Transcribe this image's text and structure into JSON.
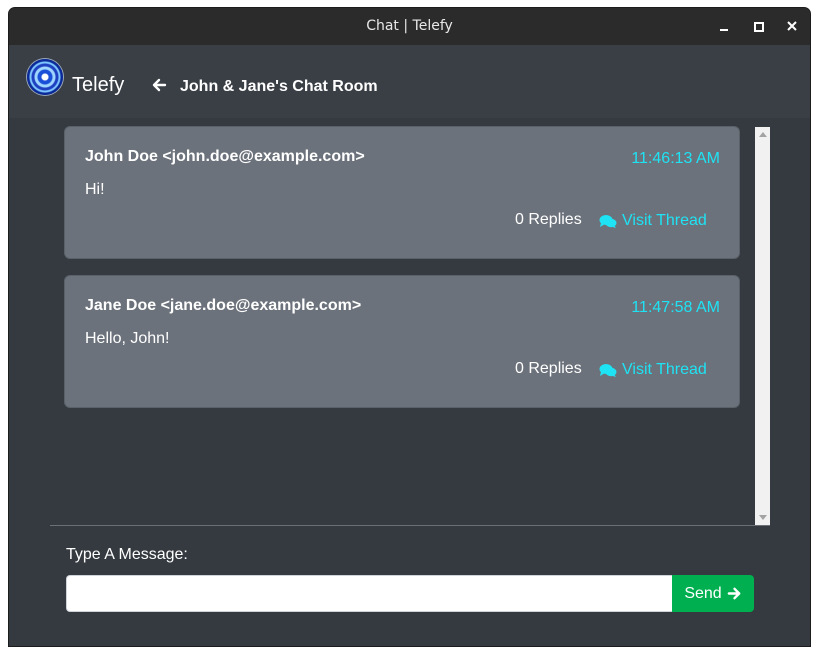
{
  "window": {
    "title": "Chat | Telefy"
  },
  "navbar": {
    "brand": "Telefy",
    "room_title": "John & Jane's Chat Room"
  },
  "messages": [
    {
      "author": "John Doe <john.doe@example.com>",
      "time": "11:46:13 AM",
      "text": "Hi!",
      "replies": "0 Replies",
      "visit_label": "Visit Thread"
    },
    {
      "author": "Jane Doe <jane.doe@example.com>",
      "time": "11:47:58 AM",
      "text": "Hello, John!",
      "replies": "0 Replies",
      "visit_label": "Visit Thread"
    }
  ],
  "composer": {
    "label": "Type A Message:",
    "value": "",
    "send_label": "Send"
  },
  "icons": {
    "logo": "telefy-logo",
    "back": "arrow-left-icon",
    "thread": "comments-icon",
    "send": "arrow-right-icon"
  },
  "colors": {
    "accent": "#1ee3f4",
    "send_button": "#00b050",
    "card": "#6c727b",
    "background": "#343a40"
  }
}
